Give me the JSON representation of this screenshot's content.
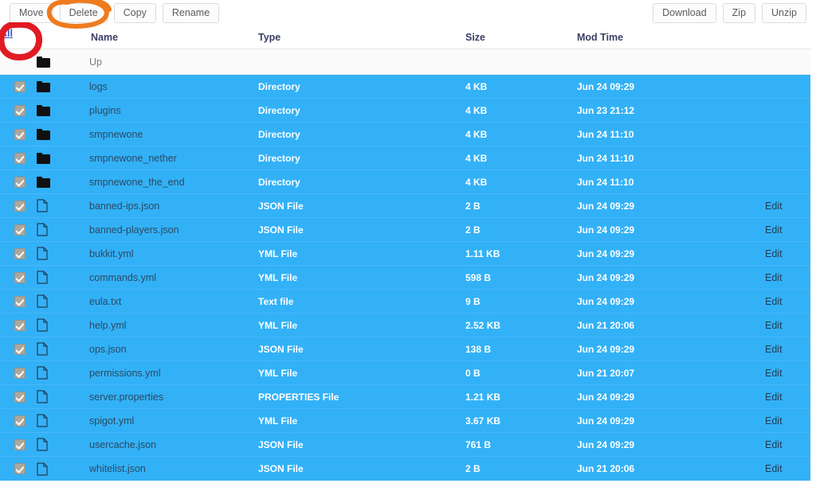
{
  "toolbar": {
    "left_buttons": [
      {
        "label": "Move",
        "name": "move-button"
      },
      {
        "label": "Delete",
        "name": "delete-button"
      },
      {
        "label": "Copy",
        "name": "copy-button"
      },
      {
        "label": "Rename",
        "name": "rename-button"
      }
    ],
    "right_buttons": [
      {
        "label": "Download",
        "name": "download-button"
      },
      {
        "label": "Zip",
        "name": "zip-button"
      },
      {
        "label": "Unzip",
        "name": "unzip-button"
      }
    ]
  },
  "table": {
    "select_all_label": "All",
    "columns": {
      "name": "Name",
      "type": "Type",
      "size": "Size",
      "mod_time": "Mod Time"
    },
    "edit_label": "Edit",
    "up_row": {
      "name": "Up",
      "icon": "folder-icon",
      "checked": false,
      "selected": false
    },
    "rows": [
      {
        "checked": true,
        "icon": "folder-icon",
        "name": "logs",
        "type": "Directory",
        "size": "4 KB",
        "mod_time": "Jun 24 09:29",
        "edit": ""
      },
      {
        "checked": true,
        "icon": "folder-icon",
        "name": "plugins",
        "type": "Directory",
        "size": "4 KB",
        "mod_time": "Jun 23 21:12",
        "edit": ""
      },
      {
        "checked": true,
        "icon": "folder-icon",
        "name": "smpnewone",
        "type": "Directory",
        "size": "4 KB",
        "mod_time": "Jun 24 11:10",
        "edit": ""
      },
      {
        "checked": true,
        "icon": "folder-icon",
        "name": "smpnewone_nether",
        "type": "Directory",
        "size": "4 KB",
        "mod_time": "Jun 24 11:10",
        "edit": ""
      },
      {
        "checked": true,
        "icon": "folder-icon",
        "name": "smpnewone_the_end",
        "type": "Directory",
        "size": "4 KB",
        "mod_time": "Jun 24 11:10",
        "edit": ""
      },
      {
        "checked": true,
        "icon": "file-icon",
        "name": "banned-ips.json",
        "type": "JSON File",
        "size": "2 B",
        "mod_time": "Jun 24 09:29",
        "edit": "Edit"
      },
      {
        "checked": true,
        "icon": "file-icon",
        "name": "banned-players.json",
        "type": "JSON File",
        "size": "2 B",
        "mod_time": "Jun 24 09:29",
        "edit": "Edit"
      },
      {
        "checked": true,
        "icon": "file-icon",
        "name": "bukkit.yml",
        "type": "YML File",
        "size": "1.11 KB",
        "mod_time": "Jun 24 09:29",
        "edit": "Edit"
      },
      {
        "checked": true,
        "icon": "file-icon",
        "name": "commands.yml",
        "type": "YML File",
        "size": "598 B",
        "mod_time": "Jun 24 09:29",
        "edit": "Edit"
      },
      {
        "checked": true,
        "icon": "file-icon",
        "name": "eula.txt",
        "type": "Text file",
        "size": "9 B",
        "mod_time": "Jun 24 09:29",
        "edit": "Edit"
      },
      {
        "checked": true,
        "icon": "file-icon",
        "name": "help.yml",
        "type": "YML File",
        "size": "2.52 KB",
        "mod_time": "Jun 21 20:06",
        "edit": "Edit"
      },
      {
        "checked": true,
        "icon": "file-icon",
        "name": "ops.json",
        "type": "JSON File",
        "size": "138 B",
        "mod_time": "Jun 24 09:29",
        "edit": "Edit"
      },
      {
        "checked": true,
        "icon": "file-icon",
        "name": "permissions.yml",
        "type": "YML File",
        "size": "0 B",
        "mod_time": "Jun 21 20:07",
        "edit": "Edit"
      },
      {
        "checked": true,
        "icon": "file-icon",
        "name": "server.properties",
        "type": "PROPERTIES File",
        "size": "1.21 KB",
        "mod_time": "Jun 24 09:29",
        "edit": "Edit"
      },
      {
        "checked": true,
        "icon": "file-icon",
        "name": "spigot.yml",
        "type": "YML File",
        "size": "3.67 KB",
        "mod_time": "Jun 24 09:29",
        "edit": "Edit"
      },
      {
        "checked": true,
        "icon": "file-icon",
        "name": "usercache.json",
        "type": "JSON File",
        "size": "761 B",
        "mod_time": "Jun 24 09:29",
        "edit": "Edit"
      },
      {
        "checked": true,
        "icon": "file-icon",
        "name": "whitelist.json",
        "type": "JSON File",
        "size": "2 B",
        "mod_time": "Jun 21 20:06",
        "edit": "Edit"
      }
    ]
  },
  "annotations": [
    {
      "name": "orange-circle-annotation",
      "shape": "hand-drawn-ellipse",
      "color": "#ef7b1e",
      "target": "delete-button"
    },
    {
      "name": "red-circle-annotation",
      "shape": "hand-drawn-ellipse",
      "color": "#e01b24",
      "target": "select-all-link"
    }
  ],
  "colors": {
    "row_selected": "#33b1f7",
    "row_border": "#47b9f8",
    "header_text": "#3b3f66",
    "link": "#3355cc",
    "annotation_orange": "#ef7b1e",
    "annotation_red": "#e01b24"
  }
}
